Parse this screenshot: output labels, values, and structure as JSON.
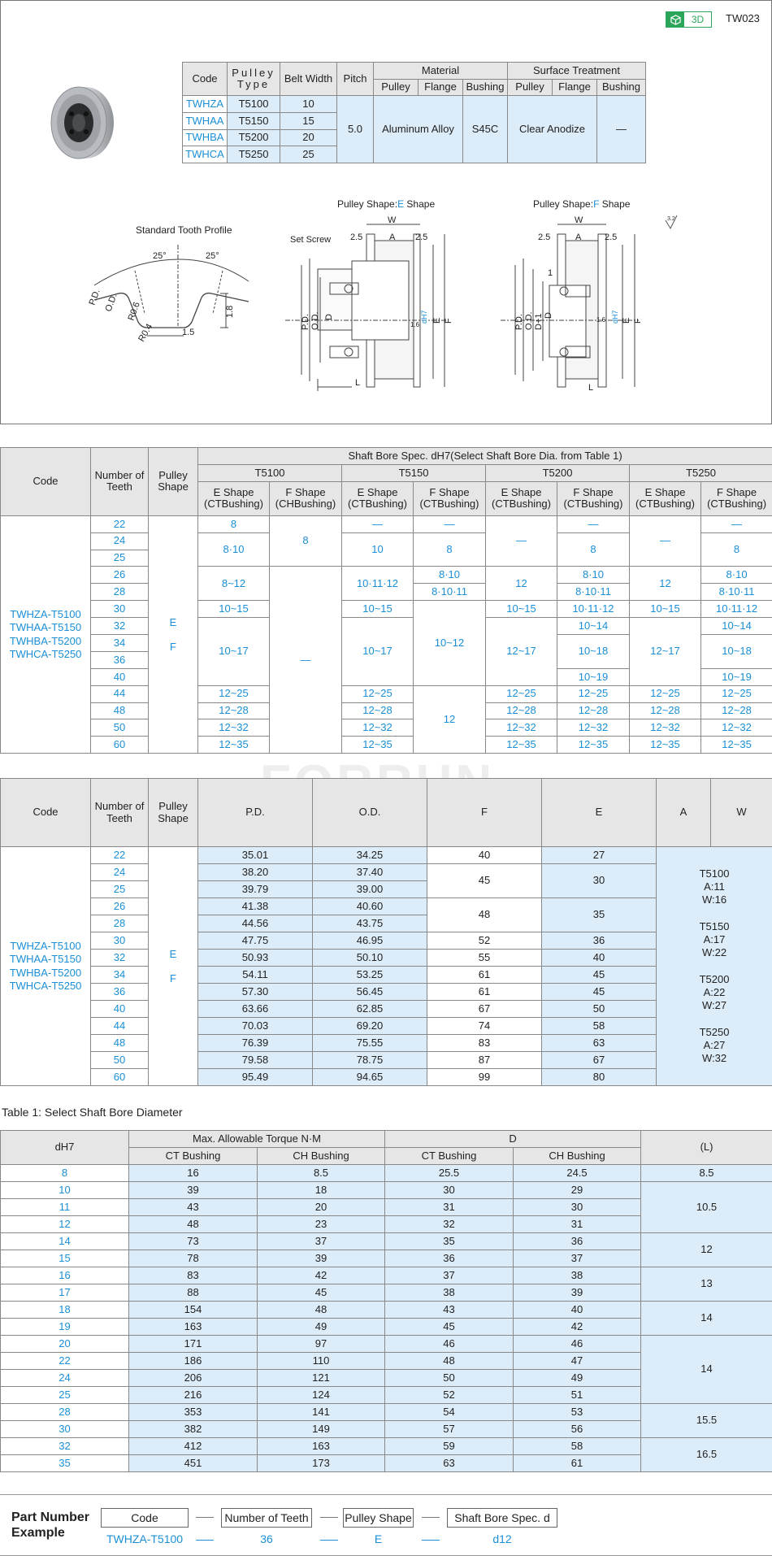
{
  "header": {
    "badge_3d": "3D",
    "code": "TW023"
  },
  "spec_table": {
    "headers": {
      "code": "Code",
      "pulley_type": "Pulley Type",
      "belt_width": "Belt Width",
      "pitch": "Pitch",
      "material": "Material",
      "surface": "Surface Treatment",
      "pulley": "Pulley",
      "flange": "Flange",
      "bushing": "Bushing"
    },
    "rows": [
      {
        "code": "TWHZA",
        "type": "T5100",
        "width": "10"
      },
      {
        "code": "TWHAA",
        "type": "T5150",
        "width": "15"
      },
      {
        "code": "TWHBA",
        "type": "T5200",
        "width": "20"
      },
      {
        "code": "TWHCA",
        "type": "T5250",
        "width": "25"
      }
    ],
    "pitch": "5.0",
    "mat_pulley_flange": "Aluminum Alloy",
    "mat_bushing": "S45C",
    "surf_pulley_flange": "Clear Anodize",
    "surf_bushing": "—"
  },
  "drawings": {
    "tooth_title": "Standard Tooth Profile",
    "e_title_prefix": "Pulley Shape:",
    "e_title_letter": "E",
    "e_title_suffix": " Shape",
    "f_title_prefix": "Pulley Shape:",
    "f_title_letter": "F",
    "f_title_suffix": " Shape",
    "tooth_labels": {
      "a1": "25°",
      "a2": "25°",
      "pd": "P.D.",
      "od": "O.D.",
      "r06": "R0.6",
      "r04": "R0.4",
      "w15": "1.5",
      "h18": "1.8"
    },
    "e_labels": {
      "set_screw": "Set Screw",
      "w": "W",
      "a": "A",
      "d25a": "2.5",
      "d25b": "2.5",
      "pd": "P.D.",
      "od": "O.D.",
      "d": "D",
      "e": "E",
      "f": "F",
      "l": "L",
      "dh7": "dH7",
      "r": "1.6"
    },
    "f_labels": {
      "w": "W",
      "a": "A",
      "d25a": "2.5",
      "d25b": "2.5",
      "one": "1",
      "pd": "P.D.",
      "od": "O.D.",
      "d1": "D+1",
      "d": "D",
      "e": "E",
      "f": "F",
      "l": "L",
      "dh7": "dH7",
      "r": "1.6"
    },
    "rough": "3.2"
  },
  "table1": {
    "h_code": "Code",
    "h_teeth": "Number of Teeth",
    "h_shape": "Pulley Shape",
    "h_spec": "Shaft Bore Spec. dH7(Select Shaft Bore Dia. from Table 1)",
    "types": [
      "T5100",
      "T5150",
      "T5200",
      "T5250"
    ],
    "e_shape": "E Shape",
    "f_shape": "F Shape",
    "ct": "(CTBushing)",
    "ch": "(CHBushing)",
    "codes": [
      "TWHZA-T5100",
      "TWHAA-T5150",
      "TWHBA-T5200",
      "TWHCA-T5250"
    ],
    "shape_e": "E",
    "shape_f": "F",
    "teeth": [
      "22",
      "24",
      "25",
      "26",
      "28",
      "30",
      "32",
      "34",
      "36",
      "40",
      "44",
      "48",
      "50",
      "60"
    ],
    "c": {
      "a1": "8",
      "a2": "8·10",
      "a3": "8~12",
      "a4": "10~15",
      "a5": "10~17",
      "a6": "12~25",
      "a7": "12~28",
      "a8": "12~32",
      "a9": "12~35",
      "b1": "8",
      "b2": "—",
      "c1": "—",
      "c2": "10",
      "c3": "10·11·12",
      "c4": "10~15",
      "c5": "10~17",
      "c6": "12~25",
      "c7": "12~28",
      "c8": "12~32",
      "c9": "12~35",
      "d1": "—",
      "d2": "8",
      "d3": "8·10",
      "d4": "8·10·11",
      "d5": "10~12",
      "d6": "12",
      "e1": "—",
      "e2": "12",
      "e3": "10~15",
      "e4": "12~17",
      "e5": "12~25",
      "e6": "12~28",
      "e7": "12~32",
      "e8": "12~35",
      "f1": "—",
      "f2": "8",
      "f3": "8·10",
      "f4": "8·10·11",
      "f5": "10·11·12",
      "f6": "10~14",
      "f7": "10~18",
      "f8": "10~19",
      "f9": "12~25",
      "f10": "12~28",
      "f11": "12~32",
      "f12": "12~35",
      "g1": "—",
      "g2": "12",
      "g3": "10~15",
      "g4": "12~17",
      "g5": "12~25",
      "g6": "12~28",
      "g7": "12~32",
      "g8": "12~35",
      "h1": "—",
      "h2": "8",
      "h3": "8·10",
      "h4": "8·10·11",
      "h5": "10·11·12",
      "h6": "10~14",
      "h7": "10~18",
      "h8": "10~19",
      "h9": "12~25",
      "h10": "12~28",
      "h11": "12~32",
      "h12": "12~35"
    }
  },
  "watermark": "FORRUN",
  "table2": {
    "headers": [
      "Code",
      "Number of Teeth",
      "Pulley Shape",
      "P.D.",
      "O.D.",
      "F",
      "E",
      "A",
      "W"
    ],
    "rows": [
      [
        "22",
        "35.01",
        "34.25"
      ],
      [
        "24",
        "38.20",
        "37.40"
      ],
      [
        "25",
        "39.79",
        "39.00"
      ],
      [
        "26",
        "41.38",
        "40.60"
      ],
      [
        "28",
        "44.56",
        "43.75"
      ],
      [
        "30",
        "47.75",
        "46.95"
      ],
      [
        "32",
        "50.93",
        "50.10"
      ],
      [
        "34",
        "54.11",
        "53.25"
      ],
      [
        "36",
        "57.30",
        "56.45"
      ],
      [
        "40",
        "63.66",
        "62.85"
      ],
      [
        "44",
        "70.03",
        "69.20"
      ],
      [
        "48",
        "76.39",
        "75.55"
      ],
      [
        "50",
        "79.58",
        "78.75"
      ],
      [
        "60",
        "95.49",
        "94.65"
      ]
    ],
    "f": {
      "r22": "40",
      "r2425": "45",
      "r2628": "48",
      "r30": "52",
      "r32": "55",
      "r34": "61",
      "r36": "61",
      "r40": "67",
      "r44": "74",
      "r48": "83",
      "r50": "87",
      "r60": "99"
    },
    "e": {
      "r22": "27",
      "r2425": "30",
      "r2628": "35",
      "r30": "36",
      "r32": "40",
      "r34": "45",
      "r36": "45",
      "r40": "50",
      "r44": "58",
      "r48": "63",
      "r50": "67",
      "r60": "80"
    },
    "aw": [
      {
        "t": "T5100",
        "a": "A:11",
        "w": "W:16"
      },
      {
        "t": "T5150",
        "a": "A:17",
        "w": "W:22"
      },
      {
        "t": "T5200",
        "a": "A:22",
        "w": "W:27"
      },
      {
        "t": "T5250",
        "a": "A:27",
        "w": "W:32"
      }
    ]
  },
  "table3": {
    "caption": "Table 1: Select Shaft Bore Diameter",
    "h_d": "dH7",
    "h_torque": "Max. Allowable Torque N·M",
    "h_D": "D",
    "h_L": "(L)",
    "ct": "CT Bushing",
    "ch": "CH Bushing",
    "rows": [
      [
        "8",
        "16",
        "8.5",
        "25.5",
        "24.5"
      ],
      [
        "10",
        "39",
        "18",
        "30",
        "29"
      ],
      [
        "11",
        "43",
        "20",
        "31",
        "30"
      ],
      [
        "12",
        "48",
        "23",
        "32",
        "31"
      ],
      [
        "14",
        "73",
        "37",
        "35",
        "36"
      ],
      [
        "15",
        "78",
        "39",
        "36",
        "37"
      ],
      [
        "16",
        "83",
        "42",
        "37",
        "38"
      ],
      [
        "17",
        "88",
        "45",
        "38",
        "39"
      ],
      [
        "18",
        "154",
        "48",
        "43",
        "40"
      ],
      [
        "19",
        "163",
        "49",
        "45",
        "42"
      ],
      [
        "20",
        "171",
        "97",
        "46",
        "46"
      ],
      [
        "22",
        "186",
        "110",
        "48",
        "47"
      ],
      [
        "24",
        "206",
        "121",
        "50",
        "49"
      ],
      [
        "25",
        "216",
        "124",
        "52",
        "51"
      ],
      [
        "28",
        "353",
        "141",
        "54",
        "53"
      ],
      [
        "30",
        "382",
        "149",
        "57",
        "56"
      ],
      [
        "32",
        "412",
        "163",
        "59",
        "58"
      ],
      [
        "35",
        "451",
        "173",
        "63",
        "61"
      ]
    ],
    "L": {
      "l8": "8.5",
      "l10": "10.5",
      "l14": "12",
      "l16": "13",
      "l18": "14",
      "l20": "14",
      "l28": "15.5",
      "l32": "16.5"
    }
  },
  "part_number": {
    "label1": "Part Number",
    "label2": "Example",
    "boxes": [
      "Code",
      "Number of Teeth",
      "Pulley Shape",
      "Shaft Bore Spec. d"
    ],
    "values": [
      "TWHZA-T5100",
      "36",
      "E",
      "d12"
    ]
  }
}
